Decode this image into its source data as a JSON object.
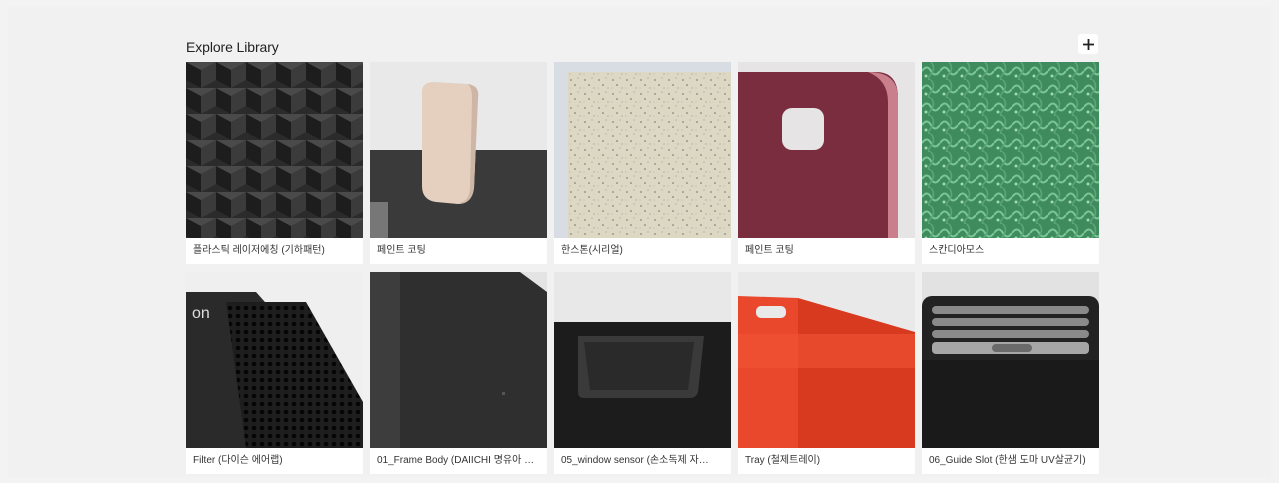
{
  "library": {
    "title": "Explore Library",
    "add_icon": "plus-icon",
    "items": [
      {
        "label": "플라스틱 레이저에칭 (기하패턴)"
      },
      {
        "label": "페인트 코팅"
      },
      {
        "label": "한스톤(시리얼)"
      },
      {
        "label": "페인트 코팅"
      },
      {
        "label": "스칸디아모스"
      },
      {
        "label": "Filter (다이슨 에어랩)"
      },
      {
        "label": "01_Frame Body (DAIICHI 명유아 …"
      },
      {
        "label": "05_window sensor (손소독제 자…"
      },
      {
        "label": "Tray (철제트레이)"
      },
      {
        "label": "06_Guide Slot (한샘 도마 UV살균기)"
      }
    ]
  }
}
